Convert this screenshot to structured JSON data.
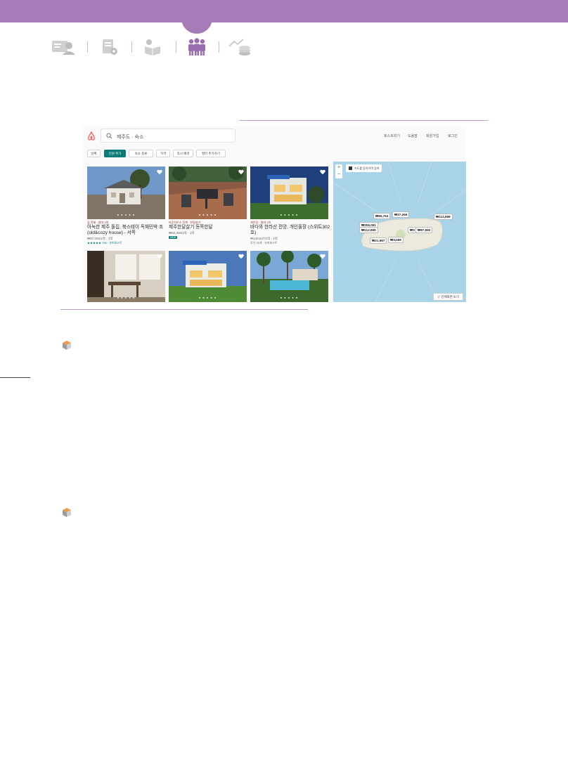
{
  "colors": {
    "theme_purple": "#a57cb8",
    "airbnb_red": "#ff5a5f",
    "filter_active_teal": "#0a7b76"
  },
  "nav_icons": [
    "person-card-icon",
    "document-pen-icon",
    "reading-book-icon",
    "group-people-icon",
    "chart-coins-icon"
  ],
  "search": {
    "query": "제주도 · 숙소"
  },
  "top_links": [
    "호스트되기",
    "도움말",
    "회원가입",
    "로그인"
  ],
  "filters": [
    "날짜",
    "인원 추가",
    "숙소 종류",
    "가격",
    "즉시 예약",
    "필터 추가하기"
  ],
  "active_filter_index": 1,
  "listings": [
    {
      "meta": "집 전체 · 침대 1개",
      "title": "아늑한 제주 돌집, 북스테이 독채민박 조(old&cozy house) - 서쪽",
      "price": "₩87,000/1박 · 1박",
      "rating": "★★★★★ 156 · 슈퍼호스트",
      "badge": ""
    },
    {
      "meta": "타운하우스 전체 · 한달살기",
      "title": "제주한달살기 동쪽한달",
      "price": "₩52,300/1박 · 1박",
      "rating": "",
      "badge": "NEW"
    },
    {
      "meta": "개인실 · 침대 1개",
      "title": "바다와 한라산 전망, 개인풀장 (스위트302호)",
      "price": "₩149,647/1박 · 1박",
      "rating": "후기 29개 · 슈퍼호스트",
      "badge": ""
    },
    {
      "meta": "",
      "title": "",
      "price": "",
      "rating": "",
      "badge": ""
    },
    {
      "meta": "",
      "title": "",
      "price": "",
      "rating": "",
      "badge": ""
    },
    {
      "meta": "",
      "title": "",
      "price": "",
      "rating": "",
      "badge": ""
    }
  ],
  "map": {
    "checkbox_label": "지도를 움직이며 검색",
    "zoom_in": "+",
    "zoom_out": "−",
    "pins": [
      "₩65,764",
      "₩37,266",
      "₩112,898",
      "₩206,061",
      "₩112,895",
      "₩3",
      "₩97,560",
      "₩21,987",
      "₩3,089"
    ],
    "bottom_button": "☆ 전체화면 보기"
  }
}
